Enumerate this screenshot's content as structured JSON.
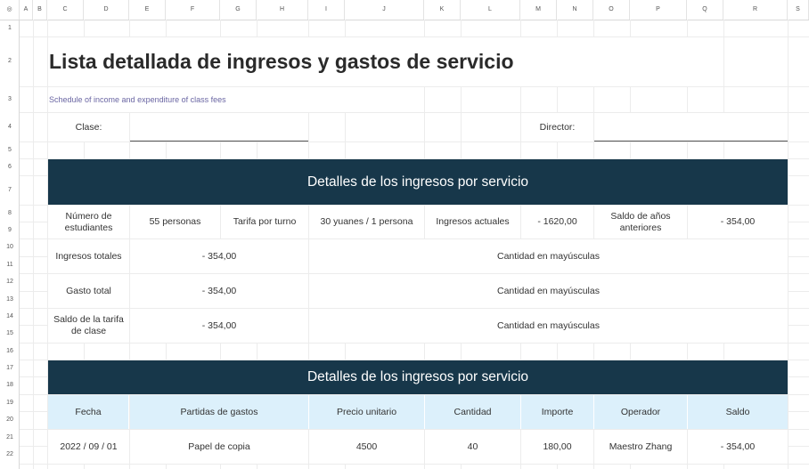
{
  "col_headers": [
    "◎",
    "A",
    "B",
    "C",
    "D",
    "E",
    "F",
    "G",
    "H",
    "I",
    "J",
    "K",
    "L",
    "M",
    "N",
    "O",
    "P",
    "Q",
    "R",
    "S"
  ],
  "row_headers": [
    "1",
    "2",
    "3",
    "4",
    "5",
    "6",
    "7",
    "8",
    "9",
    "10",
    "11",
    "12",
    "13",
    "14",
    "15",
    "16",
    "17",
    "18",
    "19",
    "20",
    "21",
    "22"
  ],
  "sheet": {
    "title": "Lista detallada de ingresos y gastos de servicio",
    "subtitle": "Schedule of income and expenditure of class fees",
    "class_label": "Clase:",
    "director_label": "Director:",
    "income_header": "Detalles de los ingresos por servicio",
    "students_label": "Número de estudiantes",
    "students_value": "55 personas",
    "rate_label": "Tarifa por turno",
    "rate_value": "30 yuanes / 1 persona",
    "actual_label": "Ingresos actuales",
    "actual_value": "- 1620,00",
    "prev_label": "Saldo de años anteriores",
    "prev_value": "- 354,00",
    "total_income_label": "Ingresos totales",
    "total_income_value": "- 354,00",
    "total_income_words": "Cantidad en mayúsculas",
    "total_expense_label": "Gasto total",
    "total_expense_value": "- 354,00",
    "total_expense_words": "Cantidad en mayúsculas",
    "balance_label": "Saldo de la tarifa de clase",
    "balance_value": "- 354,00",
    "balance_words": "Cantidad en mayúsculas",
    "expense_header": "Detalles de los ingresos por servicio",
    "expense_columns": [
      "Fecha",
      "Partidas de gastos",
      "Precio unitario",
      "Cantidad",
      "Importe",
      "Operador",
      "Saldo"
    ],
    "expense_rows": [
      [
        "2022 / 09 / 01",
        "Papel de copia",
        "4500",
        "40",
        "180,00",
        "Maestro Zhang",
        "- 354,00"
      ]
    ]
  }
}
